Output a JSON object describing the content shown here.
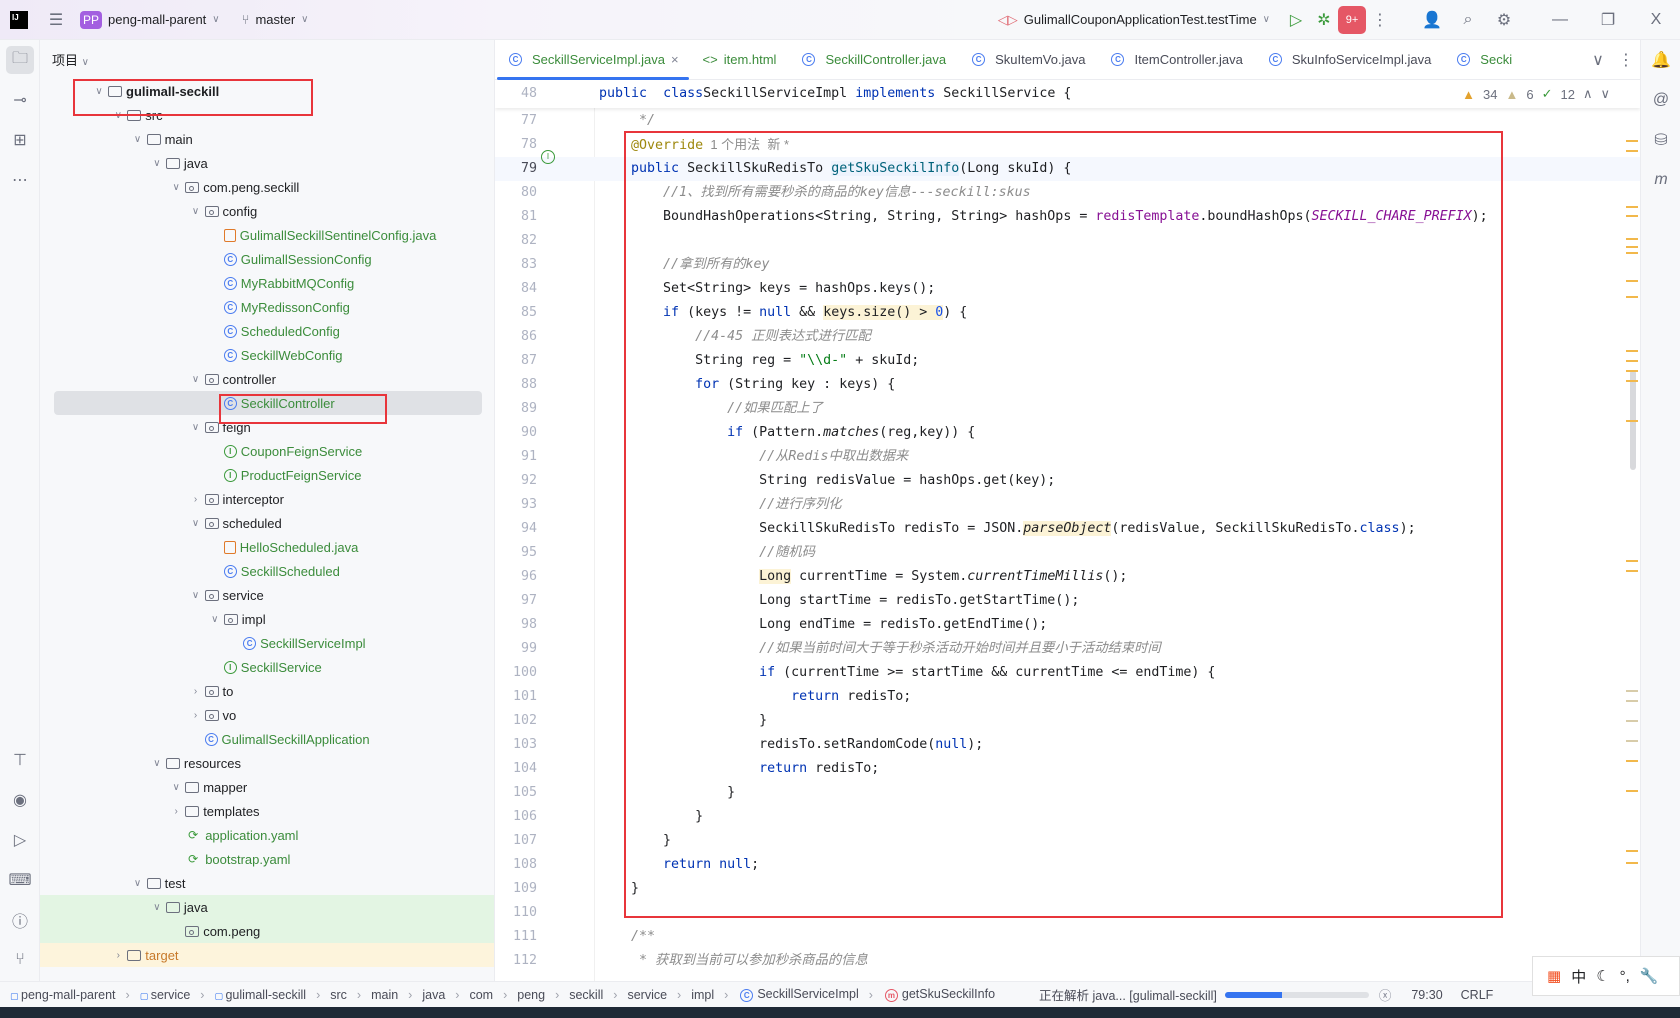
{
  "topbar": {
    "project_badge": "PP",
    "project": "peng-mall-parent",
    "branch": "master",
    "run_config": "GulimallCouponApplicationTest.testTime",
    "badge_count": "9+",
    "window_close": "X"
  },
  "project_panel": {
    "title": "项目",
    "tree": [
      {
        "label": "gulimall-seckill",
        "depth": 0,
        "type": "module",
        "expanded": true,
        "bold": true
      },
      {
        "label": "src",
        "depth": 1,
        "type": "folder",
        "expanded": true
      },
      {
        "label": "main",
        "depth": 2,
        "type": "folder",
        "expanded": true
      },
      {
        "label": "java",
        "depth": 3,
        "type": "folder",
        "expanded": true
      },
      {
        "label": "com.peng.seckill",
        "depth": 4,
        "type": "package",
        "expanded": true
      },
      {
        "label": "config",
        "depth": 5,
        "type": "package",
        "expanded": true
      },
      {
        "label": "GulimallSeckillSentinelConfig.java",
        "depth": 6,
        "type": "java",
        "green": true
      },
      {
        "label": "GulimallSessionConfig",
        "depth": 6,
        "type": "class",
        "green": true
      },
      {
        "label": "MyRabbitMQConfig",
        "depth": 6,
        "type": "class",
        "green": true
      },
      {
        "label": "MyRedissonConfig",
        "depth": 6,
        "type": "class",
        "green": true
      },
      {
        "label": "ScheduledConfig",
        "depth": 6,
        "type": "class",
        "green": true
      },
      {
        "label": "SeckillWebConfig",
        "depth": 6,
        "type": "class",
        "green": true
      },
      {
        "label": "controller",
        "depth": 5,
        "type": "package",
        "expanded": true
      },
      {
        "label": "SeckillController",
        "depth": 6,
        "type": "class",
        "green": true,
        "selected": true
      },
      {
        "label": "feign",
        "depth": 5,
        "type": "package",
        "expanded": true
      },
      {
        "label": "CouponFeignService",
        "depth": 6,
        "type": "interface",
        "green": true
      },
      {
        "label": "ProductFeignService",
        "depth": 6,
        "type": "interface",
        "green": true
      },
      {
        "label": "interceptor",
        "depth": 5,
        "type": "package",
        "expanded": false
      },
      {
        "label": "scheduled",
        "depth": 5,
        "type": "package",
        "expanded": true
      },
      {
        "label": "HelloScheduled.java",
        "depth": 6,
        "type": "java",
        "green": true
      },
      {
        "label": "SeckillScheduled",
        "depth": 6,
        "type": "class",
        "green": true
      },
      {
        "label": "service",
        "depth": 5,
        "type": "package",
        "expanded": true
      },
      {
        "label": "impl",
        "depth": 6,
        "type": "package",
        "expanded": true
      },
      {
        "label": "SeckillServiceImpl",
        "depth": 7,
        "type": "class",
        "green": true
      },
      {
        "label": "SeckillService",
        "depth": 6,
        "type": "interface",
        "green": true
      },
      {
        "label": "to",
        "depth": 5,
        "type": "package",
        "expanded": false
      },
      {
        "label": "vo",
        "depth": 5,
        "type": "package",
        "expanded": false
      },
      {
        "label": "GulimallSeckillApplication",
        "depth": 5,
        "type": "class",
        "green": true
      },
      {
        "label": "resources",
        "depth": 3,
        "type": "folder",
        "expanded": true
      },
      {
        "label": "mapper",
        "depth": 4,
        "type": "folder",
        "expanded": true
      },
      {
        "label": "templates",
        "depth": 4,
        "type": "folder",
        "expanded": false
      },
      {
        "label": "application.yaml",
        "depth": 4,
        "type": "yaml",
        "green": true
      },
      {
        "label": "bootstrap.yaml",
        "depth": 4,
        "type": "yaml",
        "green": true
      },
      {
        "label": "test",
        "depth": 2,
        "type": "folder",
        "expanded": true
      },
      {
        "label": "java",
        "depth": 3,
        "type": "folder",
        "expanded": true,
        "bg": "#e3f5e3"
      },
      {
        "label": "com.peng",
        "depth": 4,
        "type": "package",
        "bg": "#e3f5e3"
      },
      {
        "label": "target",
        "depth": 1,
        "type": "folder",
        "expanded": false,
        "bg": "#fdf4dc"
      }
    ]
  },
  "tabs": [
    {
      "label": "SeckillServiceImpl.java",
      "icon": "class",
      "active": true,
      "color": "#3b8c3b",
      "closable": true
    },
    {
      "label": "item.html",
      "icon": "html",
      "color": "#3b8c3b"
    },
    {
      "label": "SeckillController.java",
      "icon": "class",
      "color": "#3b8c3b"
    },
    {
      "label": "SkuItemVo.java",
      "icon": "class",
      "color": "#494b57"
    },
    {
      "label": "ItemController.java",
      "icon": "class",
      "color": "#494b57"
    },
    {
      "label": "SkuInfoServiceImpl.java",
      "icon": "class",
      "color": "#494b57"
    },
    {
      "label": "Secki",
      "icon": "class",
      "color": "#3b8c3b"
    }
  ],
  "inspections": {
    "warnings": "34",
    "weak_warnings": "6",
    "typos": "12"
  },
  "sticky_line": {
    "num": "48",
    "tokens": [
      [
        "kw",
        "public"
      ],
      [
        "",
        "  "
      ],
      [
        "kw",
        "class"
      ],
      [
        "",
        ""
      ],
      [
        "",
        "SeckillServiceImpl "
      ],
      [
        "kw",
        "implements"
      ],
      [
        "",
        " SeckillService {"
      ]
    ]
  },
  "code": [
    {
      "num": "77",
      "tokens": [
        [
          "cm",
          "     */"
        ]
      ]
    },
    {
      "num": "78",
      "tokens": [
        [
          "",
          "    "
        ],
        [
          "an",
          "@Override"
        ],
        [
          "inlay",
          "  1 个用法  新 *"
        ]
      ]
    },
    {
      "num": "79",
      "current": true,
      "tokens": [
        [
          "",
          "    "
        ],
        [
          "kw",
          "public"
        ],
        [
          "",
          " SeckillSkuRedisTo "
        ],
        [
          "fn",
          "getSkuSeckilInfo"
        ],
        [
          "",
          "(Long skuId) {"
        ]
      ]
    },
    {
      "num": "80",
      "tokens": [
        [
          "",
          "        "
        ],
        [
          "cm",
          "//1、找到所有需要秒杀的商品的key信息---seckill:skus"
        ]
      ]
    },
    {
      "num": "81",
      "tokens": [
        [
          "",
          "        BoundHashOperations<String, String, String> hashOps = "
        ],
        [
          "fld",
          "redisTemplate"
        ],
        [
          "",
          ".boundHashOps("
        ],
        [
          "fst",
          "SECKILL_CHARE_PREFIX"
        ],
        [
          "",
          ");"
        ]
      ]
    },
    {
      "num": "82",
      "tokens": []
    },
    {
      "num": "83",
      "tokens": [
        [
          "",
          "        "
        ],
        [
          "cm",
          "//拿到所有的key"
        ]
      ]
    },
    {
      "num": "84",
      "tokens": [
        [
          "",
          "        Set<String> keys = hashOps.keys();"
        ]
      ]
    },
    {
      "num": "85",
      "tokens": [
        [
          "",
          "        "
        ],
        [
          "kw",
          "if"
        ],
        [
          "",
          " (keys != "
        ],
        [
          "kw",
          "null"
        ],
        [
          "",
          " && "
        ],
        [
          "hl",
          "keys.size() > "
        ],
        [
          "num hl",
          "0"
        ],
        [
          "",
          ") {"
        ]
      ]
    },
    {
      "num": "86",
      "tokens": [
        [
          "",
          "            "
        ],
        [
          "cm",
          "//4-45 正则表达式进行匹配"
        ]
      ]
    },
    {
      "num": "87",
      "tokens": [
        [
          "",
          "            String reg = "
        ],
        [
          "str",
          "\"\\\\d-\""
        ],
        [
          "",
          " + skuId;"
        ]
      ]
    },
    {
      "num": "88",
      "tokens": [
        [
          "",
          "            "
        ],
        [
          "kw",
          "for"
        ],
        [
          "",
          " (String key : keys) {"
        ]
      ]
    },
    {
      "num": "89",
      "tokens": [
        [
          "",
          "                "
        ],
        [
          "cm",
          "//如果匹配上了"
        ]
      ]
    },
    {
      "num": "90",
      "tokens": [
        [
          "",
          "                "
        ],
        [
          "kw",
          "if"
        ],
        [
          "",
          " (Pattern."
        ],
        [
          "it",
          "matches"
        ],
        [
          "",
          "(reg,key)) {"
        ]
      ]
    },
    {
      "num": "91",
      "tokens": [
        [
          "",
          "                    "
        ],
        [
          "cm",
          "//从Redis中取出数据来"
        ]
      ]
    },
    {
      "num": "92",
      "tokens": [
        [
          "",
          "                    String redisValue = hashOps.get(key);"
        ]
      ]
    },
    {
      "num": "93",
      "tokens": [
        [
          "",
          "                    "
        ],
        [
          "cm",
          "//进行序列化"
        ]
      ]
    },
    {
      "num": "94",
      "tokens": [
        [
          "",
          "                    SeckillSkuRedisTo redisTo = JSON."
        ],
        [
          "hlit",
          "parseObject"
        ],
        [
          "",
          "(redisValue, SeckillSkuRedisTo."
        ],
        [
          "kw",
          "class"
        ],
        [
          "",
          ");"
        ]
      ]
    },
    {
      "num": "95",
      "tokens": [
        [
          "",
          "                    "
        ],
        [
          "cm",
          "//随机码"
        ]
      ]
    },
    {
      "num": "96",
      "tokens": [
        [
          "",
          "                    "
        ],
        [
          "hl",
          "Long"
        ],
        [
          "",
          " currentTime = System."
        ],
        [
          "it",
          "currentTimeMillis"
        ],
        [
          "",
          "();"
        ]
      ]
    },
    {
      "num": "97",
      "tokens": [
        [
          "",
          "                    Long startTime = redisTo.getStartTime();"
        ]
      ]
    },
    {
      "num": "98",
      "tokens": [
        [
          "",
          "                    Long endTime = redisTo.getEndTime();"
        ]
      ]
    },
    {
      "num": "99",
      "tokens": [
        [
          "",
          "                    "
        ],
        [
          "cm",
          "//如果当前时间大于等于秒杀活动开始时间并且要小于活动结束时间"
        ]
      ]
    },
    {
      "num": "100",
      "tokens": [
        [
          "",
          "                    "
        ],
        [
          "kw",
          "if"
        ],
        [
          "",
          " (currentTime >= startTime && currentTime <= endTime) {"
        ]
      ]
    },
    {
      "num": "101",
      "tokens": [
        [
          "",
          "                        "
        ],
        [
          "kw",
          "return"
        ],
        [
          "",
          " redisTo;"
        ]
      ]
    },
    {
      "num": "102",
      "tokens": [
        [
          "",
          "                    }"
        ]
      ]
    },
    {
      "num": "103",
      "tokens": [
        [
          "",
          "                    redisTo.setRandomCode("
        ],
        [
          "kw",
          "null"
        ],
        [
          "",
          ");"
        ]
      ]
    },
    {
      "num": "104",
      "tokens": [
        [
          "",
          "                    "
        ],
        [
          "kw",
          "return"
        ],
        [
          "",
          " redisTo;"
        ]
      ]
    },
    {
      "num": "105",
      "tokens": [
        [
          "",
          "                }"
        ]
      ]
    },
    {
      "num": "106",
      "tokens": [
        [
          "",
          "            }"
        ]
      ]
    },
    {
      "num": "107",
      "tokens": [
        [
          "",
          "        }"
        ]
      ]
    },
    {
      "num": "108",
      "tokens": [
        [
          "",
          "        "
        ],
        [
          "kw",
          "return"
        ],
        [
          "",
          " "
        ],
        [
          "kw",
          "null"
        ],
        [
          "",
          ";"
        ]
      ]
    },
    {
      "num": "109",
      "tokens": [
        [
          "",
          "    }"
        ]
      ]
    },
    {
      "num": "110",
      "tokens": []
    },
    {
      "num": "111",
      "tokens": [
        [
          "",
          "    "
        ],
        [
          "cm",
          "/**"
        ]
      ]
    },
    {
      "num": "112",
      "tokens": [
        [
          "",
          "     "
        ],
        [
          "cm",
          "* 获取到当前可以参加秒杀商品的信息"
        ]
      ]
    }
  ],
  "statusbar": {
    "breadcrumbs": [
      "peng-mall-parent",
      "service",
      "gulimall-seckill",
      "src",
      "main",
      "java",
      "com",
      "peng",
      "seckill",
      "service",
      "impl",
      "SeckillServiceImpl",
      "getSkuSeckilInfo"
    ],
    "task": "正在解析 java... [gulimall-seckill]",
    "progress_percent": 40,
    "position": "79:30",
    "line_ending": "CRLF"
  },
  "ime": {
    "mode": "中",
    "punct": "°,"
  },
  "colors": {
    "accent": "#3574f0",
    "highlight_box": "#e8353b",
    "run_green": "#3b9a3b",
    "badge_red": "#e55765"
  }
}
